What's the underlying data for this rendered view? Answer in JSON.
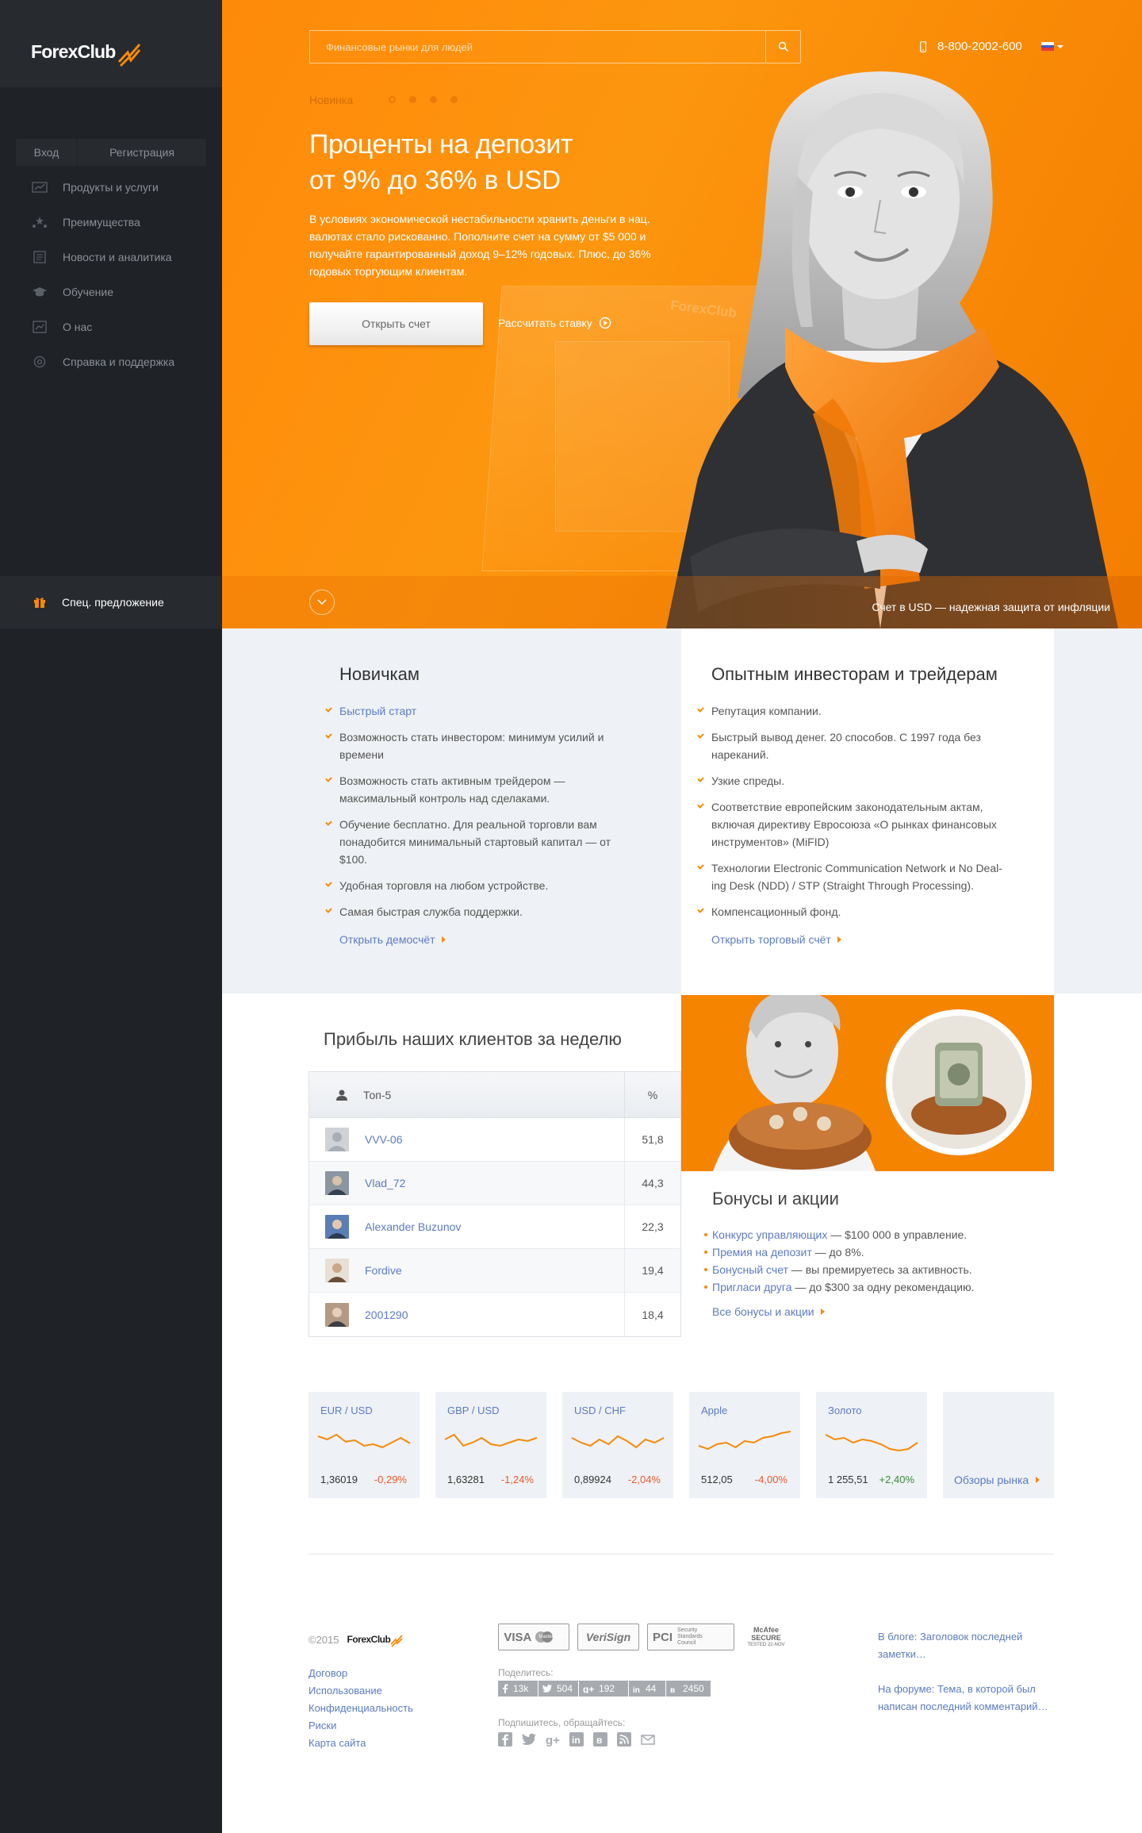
{
  "brand": {
    "name": "ForexClub"
  },
  "sidebar": {
    "login_label": "Вход",
    "register_label": "Регистрация",
    "items": [
      {
        "label": "Продукты и услуги",
        "icon": "chart-icon"
      },
      {
        "label": "Преимущества",
        "icon": "stars-icon"
      },
      {
        "label": "Новости и аналитика",
        "icon": "news-icon"
      },
      {
        "label": "Обучение",
        "icon": "graduation-cap-icon"
      },
      {
        "label": "О нас",
        "icon": "about-chart-icon"
      },
      {
        "label": "Справка и поддержка",
        "icon": "help-icon"
      }
    ],
    "promo_label": "Спец. предложение"
  },
  "header": {
    "search_placeholder": "Финансовые рынки для людей",
    "phone": "8-800-2002-600"
  },
  "hero": {
    "badge": "Новинка",
    "title_line1": "Проценты на депозит",
    "title_line2": "от 9% до 36% в USD",
    "description": "В условиях экономической нестабильности хранить деньги в нац. валютах стало рискованно. Пополните счет на сумму от $5 000 и получайте гарантированный доход 9–12% годовых. Плюс, до 36% годовых торгующим клиентам.",
    "cta_label": "Открыть счет",
    "calc_label": "Рассчитать ставку",
    "caption": "Счет в USD — надежная защита от инфляции",
    "watermark": "ForexClub"
  },
  "newbies": {
    "title": "Новичкам",
    "items": [
      "Быстрый старт",
      "Возможность стать инвестором: минимум усилий и времени",
      "Возможность стать активным трейдером — максимальный контроль над сделаками.",
      "Обучение бесплатно. Для  реальной торговли вам понадобится минимальный стартовый капитал — от $100.",
      "Удобная торговля на любом устройстве.",
      "Самая быстрая служба поддержки."
    ],
    "more": "Открыть демосчёт"
  },
  "pros": {
    "title": "Опытным инвесторам и трейдерам",
    "items": [
      "Репутация компании.",
      "Быстрый вывод денег. 20 способов. С 1997 года без нареканий.",
      "Узкие спреды.",
      "Соответствие европейским законодательным актам, включая директиву Евросоюза «О рынках финансовых инструментов» (MiFID)",
      "Технологии Electronic Communication Network и No Deal-ing Desk (NDD) / STP (Straight Through Processing).",
      "Компенсационный фонд."
    ],
    "more": "Открыть торговый счёт"
  },
  "profit": {
    "title": "Прибыль наших клиентов за неделю",
    "col_name": "Топ-5",
    "col_pct": "%",
    "rows": [
      {
        "name": "VVV-06",
        "pct": "51,8"
      },
      {
        "name": "Vlad_72",
        "pct": "44,3"
      },
      {
        "name": "Alexander Buzunov",
        "pct": "22,3"
      },
      {
        "name": "Fordive",
        "pct": "19,4"
      },
      {
        "name": "2001290",
        "pct": "18,4"
      }
    ]
  },
  "bonus": {
    "title": "Бонусы и акции",
    "items": [
      {
        "link": "Конкурс управляющих",
        "text": " — $100 000 в управление."
      },
      {
        "link": "Премия на депозит",
        "text": " — до 8%."
      },
      {
        "link": "Бонусный счет",
        "text": " — вы премируетесь за активность."
      },
      {
        "link": "Пригласи друга",
        "text": " — до $300 за одну рекомендацию."
      }
    ],
    "more": "Все бонусы и акции"
  },
  "quotes": [
    {
      "name": "EUR / USD",
      "price": "1,36019",
      "change": "-0,29%",
      "dir": "down",
      "spark": [
        22,
        18,
        24,
        15,
        17,
        10,
        12,
        8,
        14,
        20,
        13
      ]
    },
    {
      "name": "GBP / USD",
      "price": "1,63281",
      "change": "-1,24%",
      "dir": "down",
      "spark": [
        18,
        24,
        10,
        14,
        20,
        12,
        10,
        14,
        18,
        16,
        20
      ]
    },
    {
      "name": "USD / CHF",
      "price": "0,89924",
      "change": "-2,04%",
      "dir": "down",
      "spark": [
        20,
        14,
        10,
        18,
        12,
        22,
        16,
        8,
        18,
        14,
        20
      ]
    },
    {
      "name": "Apple",
      "price": "512,05",
      "change": "-4,00%",
      "dir": "down",
      "spark": [
        10,
        6,
        12,
        14,
        8,
        16,
        14,
        20,
        22,
        26,
        28
      ]
    },
    {
      "name": "Золото",
      "price": "1 255,51",
      "change": "+2,40%",
      "dir": "up",
      "spark": [
        24,
        18,
        20,
        14,
        18,
        16,
        12,
        6,
        4,
        6,
        14
      ]
    }
  ],
  "quotes_more": "Обзоры рынка",
  "footer": {
    "copyright": "©2015",
    "links": [
      "Договор",
      "Использование",
      "Конфиденциальность",
      "Риски",
      "Карта сайта"
    ],
    "certs": [
      "VISA",
      "VeriSign",
      "PCI",
      "McAfee SECURE"
    ],
    "cert_mc": "MasterCard",
    "cert_pci_sub": "Security Standards Council",
    "cert_mcafee_sub": "TESTED 22-NOV",
    "share_label": "Поделитесь:",
    "shares": [
      {
        "icon": "facebook-icon",
        "count": "13k"
      },
      {
        "icon": "twitter-icon",
        "count": "504"
      },
      {
        "icon": "google-plus-icon",
        "count": "192"
      },
      {
        "icon": "linkedin-icon",
        "count": "44"
      },
      {
        "icon": "vk-icon",
        "count": "2450"
      }
    ],
    "subscribe_label": "Подпишитесь, обращайтесь:",
    "blog": "В блоге: Заголовок последней заметки…",
    "forum": "На форуме: Тема, в которой был написан последний комментарий…"
  },
  "colors": {
    "accent": "#f58a07",
    "sidebar": "#1f2226",
    "link": "#5c7bbf"
  }
}
